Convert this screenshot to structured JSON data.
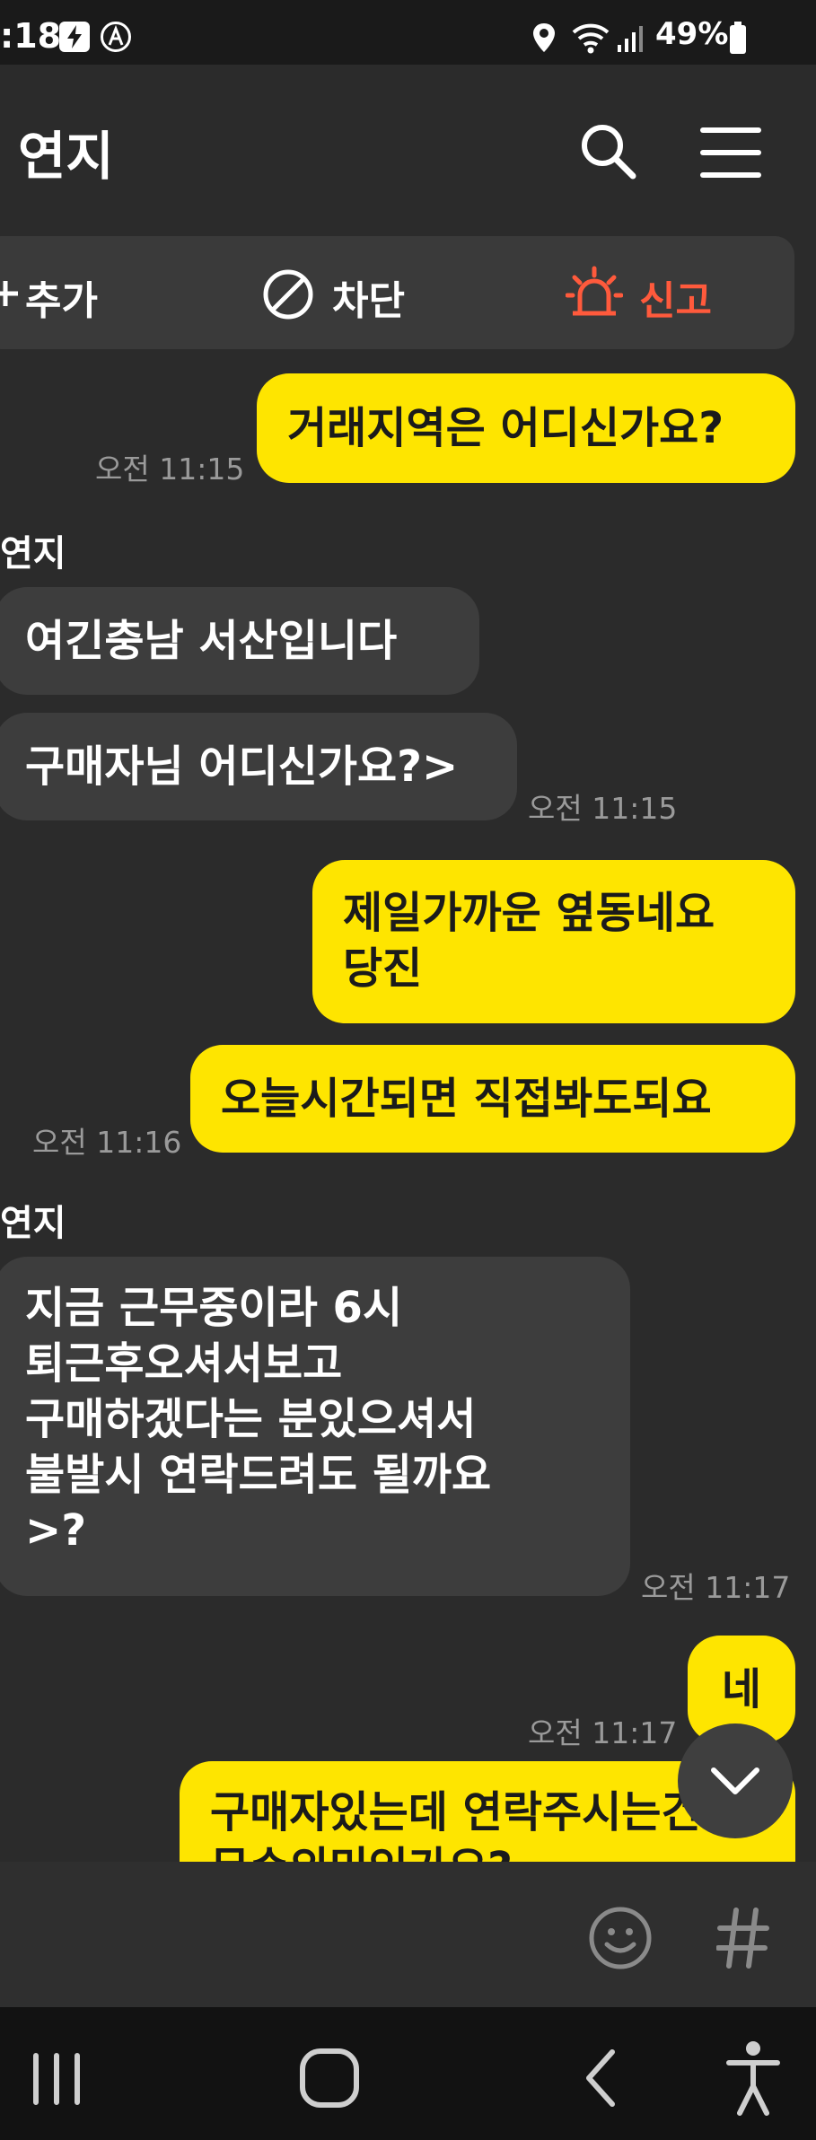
{
  "status_bar": {
    "time": ":18",
    "battery": "49%"
  },
  "header": {
    "title": "연지"
  },
  "actions": {
    "add": "추가",
    "block": "차단",
    "report": "신고"
  },
  "messages": [
    {
      "text": "거래지역은 어디신가요?",
      "time": "오전 11:15"
    },
    {
      "sender": "연지",
      "text": "여긴충남 서산입니다"
    },
    {
      "text": "구매자님 어디신가요?>",
      "time": "오전 11:15"
    },
    {
      "line1": "제일가까운 옆동네요",
      "line2": "당진"
    },
    {
      "text": "오늘시간되면 직접봐도되요",
      "time": "오전 11:16"
    },
    {
      "sender": "연지",
      "line1": "지금 근무중이라  6시",
      "line2": "퇴근후오셔서보고",
      "line3": "구매하겠다는 분있으셔서",
      "line4": "불발시 연락드려도 될까요",
      "line5": ">?",
      "time": "오전 11:17"
    },
    {
      "text": "네",
      "time": "오전 11:17"
    },
    {
      "line1": "구매자있는데 연락주시는건",
      "line2": "무슨의미인가요?"
    }
  ],
  "colors": {
    "my_bubble": "#fee500",
    "their_bubble": "#3d3d3d",
    "background": "#2b2b2b",
    "report": "#ff5a3c"
  },
  "icons": [
    "search-icon",
    "menu-icon",
    "block-icon",
    "siren-icon",
    "emoji-icon",
    "hashtag-icon",
    "chevron-down-icon"
  ]
}
